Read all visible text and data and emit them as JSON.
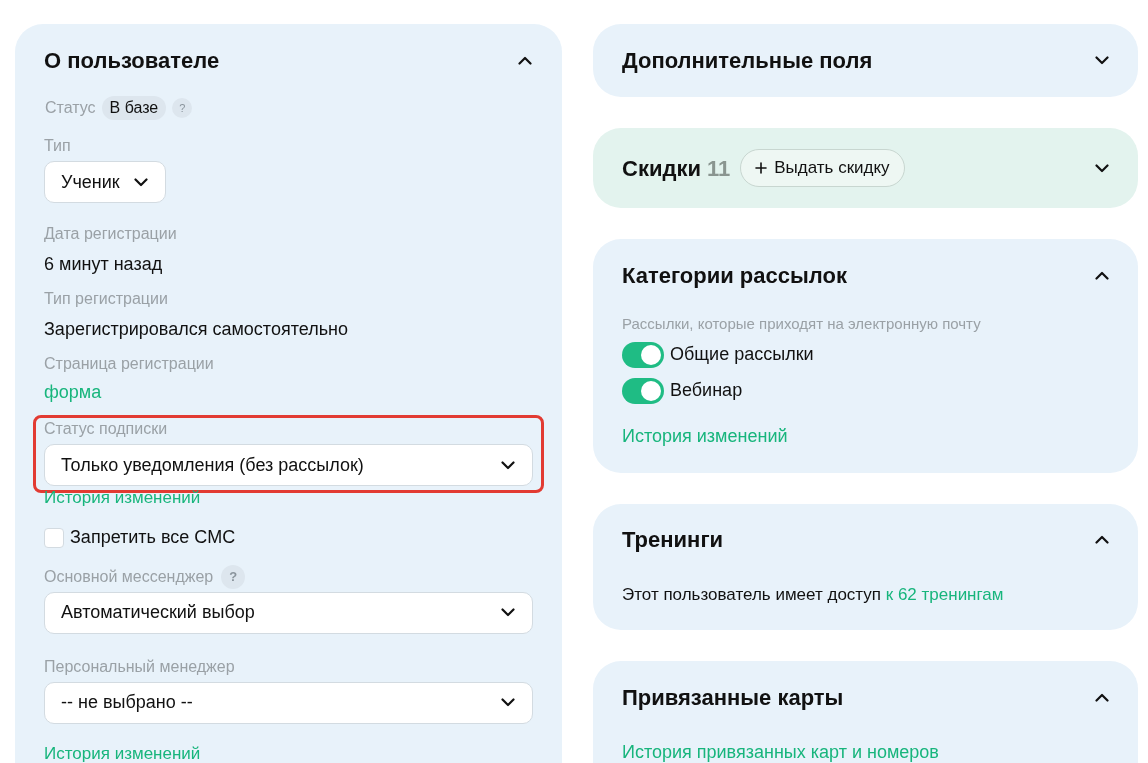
{
  "user_panel": {
    "title": "О пользователе",
    "expanded": true,
    "status": {
      "label": "Статус",
      "value": "В базе",
      "help": "?"
    },
    "fields": [
      {
        "kind": "select",
        "label": "Тип",
        "value": "Ученик",
        "compact": true,
        "highlighted": false
      },
      {
        "kind": "text",
        "label": "Дата регистрации",
        "value": "6 минут назад"
      },
      {
        "kind": "text",
        "label": "Тип регистрации",
        "value": "Зарегистрировался самостоятельно"
      },
      {
        "kind": "link",
        "label": "Страница регистрации",
        "value": "форма"
      },
      {
        "kind": "select",
        "label": "Статус подписки",
        "value": "Только уведомления (без рассылок)",
        "compact": false,
        "highlighted": true
      },
      {
        "kind": "history",
        "value": "История изменений"
      },
      {
        "kind": "checkbox",
        "value": "Запретить все СМС",
        "checked": false
      },
      {
        "kind": "select",
        "label": "Основной мессенджер",
        "help": "?",
        "value": "Автоматический выбор",
        "compact": false,
        "highlighted": false
      },
      {
        "kind": "select",
        "label": "Персональный менеджер",
        "value": "-- не выбрано --",
        "compact": false,
        "highlighted": false
      },
      {
        "kind": "history",
        "value": "История изменений"
      }
    ]
  },
  "side_panels": [
    {
      "kind": "plain",
      "title": "Дополнительные поля",
      "expanded": false
    },
    {
      "kind": "discounts",
      "title": "Скидки",
      "count": "11",
      "button": "Выдать скидку",
      "expanded": false
    },
    {
      "kind": "mailing",
      "title": "Категории рассылок",
      "expanded": true,
      "note": "Рассылки, которые приходят на электронную почту",
      "toggles": [
        {
          "label": "Общие рассылки",
          "on": true
        },
        {
          "label": "Вебинар",
          "on": true
        }
      ],
      "link": "История изменений"
    },
    {
      "kind": "access",
      "title": "Тренинги",
      "expanded": true,
      "text": "Этот пользователь имеет доступ",
      "link": "к 62 тренингам"
    },
    {
      "kind": "links",
      "title": "Привязанные карты",
      "expanded": true,
      "link": "История привязанных карт и номеров"
    }
  ]
}
